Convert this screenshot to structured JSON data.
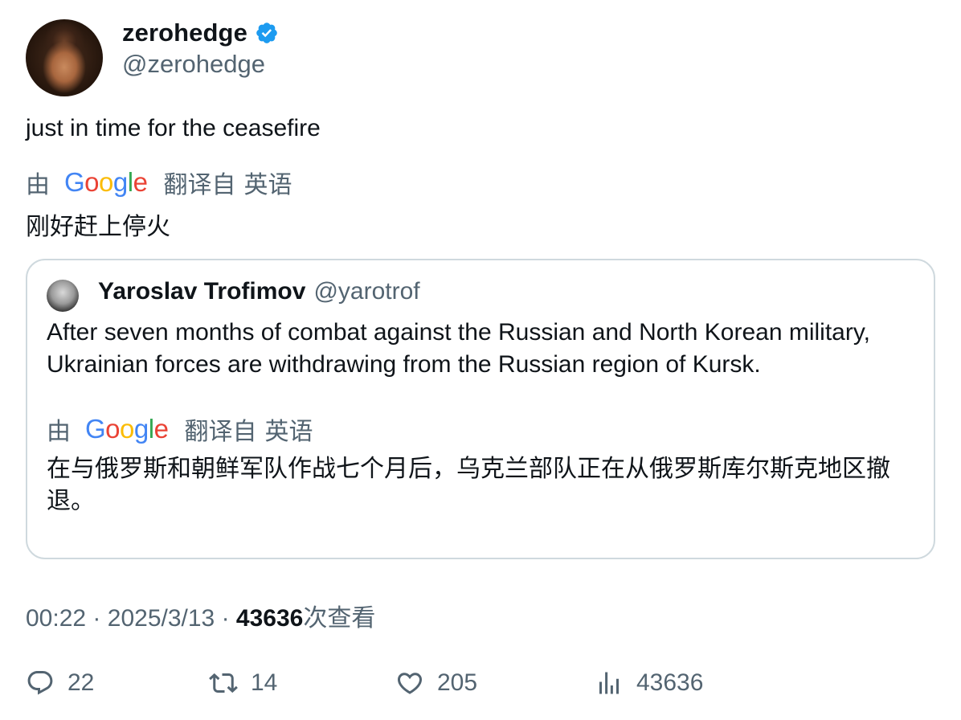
{
  "author": {
    "display_name": "zerohedge",
    "handle": "@zerohedge",
    "verified_color": "#1d9bf0"
  },
  "tweet": {
    "text": "just in time for the ceasefire",
    "translation_prefix": "由",
    "translation_brand": "Google",
    "translation_suffix": "翻译自",
    "translation_language": "英语",
    "translation": "刚好赶上停火"
  },
  "quoted": {
    "display_name": "Yaroslav Trofimov",
    "handle": "@yarotrof",
    "text": "After seven months of combat against the Russian and North Korean military, Ukrainian forces are withdrawing from the Russian region of Kursk.",
    "translation_prefix": "由",
    "translation_brand": "Google",
    "translation_suffix": "翻译自",
    "translation_language": "英语",
    "translation": "在与俄罗斯和朝鲜军队作战七个月后，乌克兰部队正在从俄罗斯库尔斯克地区撤退。"
  },
  "meta": {
    "time": "00:22",
    "separator": "·",
    "date": "2025/3/13",
    "views_count": "43636",
    "views_label": "次查看"
  },
  "actions": {
    "replies": "22",
    "retweets": "14",
    "likes": "205",
    "views": "43636",
    "icon_color": "#536471"
  }
}
